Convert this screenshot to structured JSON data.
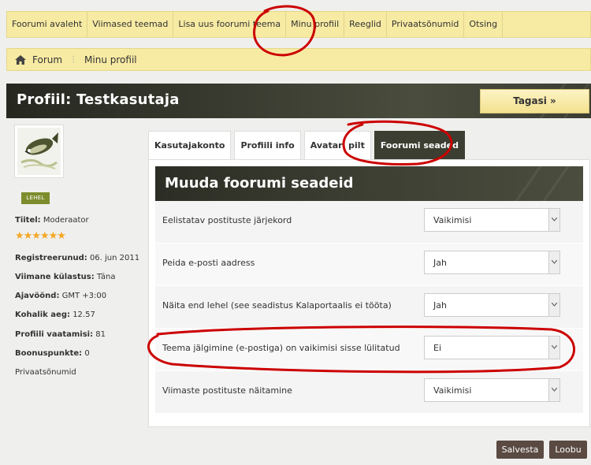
{
  "nav": {
    "items": [
      "Foorumi avaleht",
      "Viimased teemad",
      "Lisa uus foorumi teema",
      "Minu profiil",
      "Reeglid",
      "Privaatsõnumid",
      "Otsing"
    ]
  },
  "breadcrumb": {
    "home": "Forum",
    "current": "Minu profiil"
  },
  "header": {
    "title": "Profiil: Testkasutaja",
    "back_label": "Tagasi »"
  },
  "user": {
    "badge": "LEHEL",
    "title_label": "Tiitel:",
    "title_value": "Moderaator",
    "stars": "★★★★★★",
    "registered_label": "Registreerunud:",
    "registered_value": "06. jun 2011",
    "last_visit_label": "Viimane külastus:",
    "last_visit_value": "Täna",
    "timezone_label": "Ajavöönd:",
    "timezone_value": "GMT +3:00",
    "local_time_label": "Kohalik aeg:",
    "local_time_value": "12.57",
    "views_label": "Profiili vaatamisi:",
    "views_value": "81",
    "bonus_label": "Boonuspunkte:",
    "bonus_value": "0",
    "pm_link": "Privaatsõnumid"
  },
  "tabs": [
    "Kasutajakonto",
    "Profiili info",
    "Avatari pilt",
    "Foorumi seaded"
  ],
  "panel": {
    "title": "Muuda foorumi seadeid",
    "settings": [
      {
        "label": "Eelistatav postituste järjekord",
        "value": "Vaikimisi"
      },
      {
        "label": "Peida e-posti aadress",
        "value": "Jah"
      },
      {
        "label": "Näita end lehel (see seadistus Kalaportaalis ei tööta)",
        "value": "Jah"
      },
      {
        "label": "Teema jälgimine (e-postiga) on vaikimisi sisse lülitatud",
        "value": "Ei"
      },
      {
        "label": "Viimaste postituste näitamine",
        "value": "Vaikimisi"
      }
    ]
  },
  "actions": {
    "save_label": "Salvesta",
    "cancel_label": "Loobu"
  },
  "colors": {
    "nav_bg": "#f7eaa3",
    "header_dark": "#3a3c31",
    "badge": "#7d8c2c",
    "stars": "#f5a623",
    "button_dark": "#5a4a42",
    "annotation": "#cc0000"
  }
}
